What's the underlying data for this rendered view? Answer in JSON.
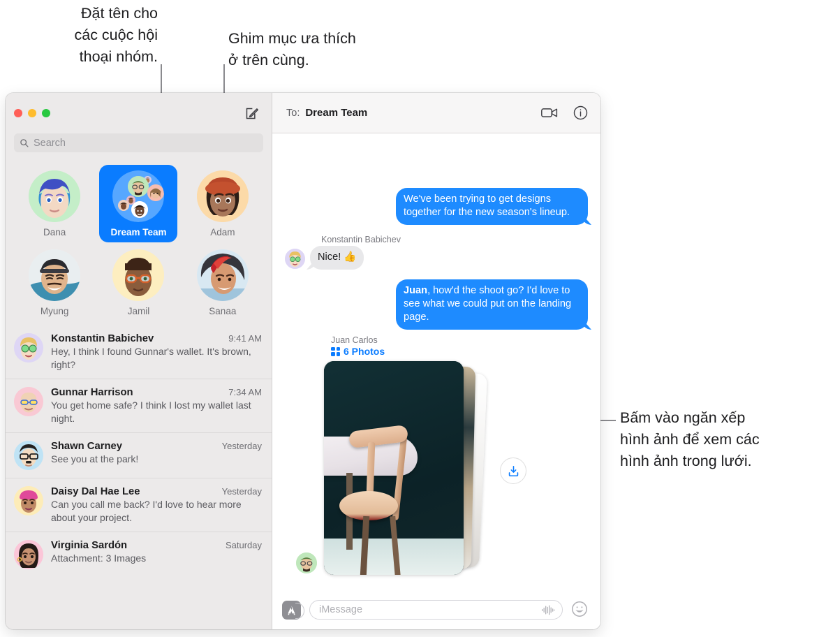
{
  "annotations": {
    "top_left": "Đặt tên cho\ncác cuộc hội\nthoại nhóm.",
    "top_mid": "Ghim mục ưa thích\nở trên cùng.",
    "right": "Bấm vào ngăn xếp\nhình ảnh để xem các\nhình ảnh trong lưới."
  },
  "sidebar": {
    "window_controls": [
      "close",
      "minimize",
      "zoom"
    ],
    "compose_icon": "compose-icon",
    "search": {
      "icon": "search-icon",
      "placeholder": "Search",
      "value": ""
    },
    "pinned": [
      {
        "name": "Dana",
        "selected": false,
        "icon": "memoji-avatar"
      },
      {
        "name": "Dream Team",
        "selected": true,
        "icon": "group-avatar"
      },
      {
        "name": "Adam",
        "selected": false,
        "icon": "memoji-avatar"
      },
      {
        "name": "Myung",
        "selected": false,
        "icon": "photo-avatar"
      },
      {
        "name": "Jamil",
        "selected": false,
        "icon": "memoji-avatar"
      },
      {
        "name": "Sanaa",
        "selected": false,
        "icon": "photo-avatar"
      }
    ],
    "conversations": [
      {
        "name": "Konstantin Babichev",
        "time": "9:41 AM",
        "preview": "Hey, I think I found Gunnar's wallet. It's brown, right?"
      },
      {
        "name": "Gunnar Harrison",
        "time": "7:34 AM",
        "preview": "You get home safe? I think I lost my wallet last night."
      },
      {
        "name": "Shawn Carney",
        "time": "Yesterday",
        "preview": "See you at the park!"
      },
      {
        "name": "Daisy Dal Hae Lee",
        "time": "Yesterday",
        "preview": "Can you call me back? I'd love to hear more about your project."
      },
      {
        "name": "Virginia Sardón",
        "time": "Saturday",
        "preview": "Attachment: 3 Images"
      }
    ]
  },
  "pane": {
    "header": {
      "to_label": "To:",
      "to_value": "Dream Team",
      "facetime_icon": "video-camera-icon",
      "info_icon": "info-icon"
    },
    "messages": [
      {
        "kind": "text",
        "direction": "out",
        "text": "We've been trying to get designs together for the new season's lineup."
      },
      {
        "kind": "text",
        "direction": "in",
        "sender": "Konstantin Babichev",
        "text": "Nice!  👍"
      },
      {
        "kind": "text",
        "direction": "out",
        "bold_prefix": "Juan",
        "text": ", how'd the shoot go? I'd love to see what we could put on the landing page."
      },
      {
        "kind": "attachment",
        "direction": "in",
        "sender": "Juan Carlos",
        "link_text": "6 Photos",
        "link_icon": "grid-icon",
        "download_icon": "download-icon"
      }
    ],
    "composer": {
      "apps_icon": "app-store-icon",
      "placeholder": "iMessage",
      "value": "",
      "audio_icon": "audio-waveform-icon",
      "emoji_icon": "smiley-icon"
    }
  },
  "colors": {
    "accent_blue": "#0a7cff",
    "bubble_out": "#1e8bff",
    "bubble_in": "#e8e8ea",
    "sidebar_bg": "#eceaea",
    "traffic_red": "#ff5f57",
    "traffic_yellow": "#febc2e",
    "traffic_green": "#28c840"
  }
}
